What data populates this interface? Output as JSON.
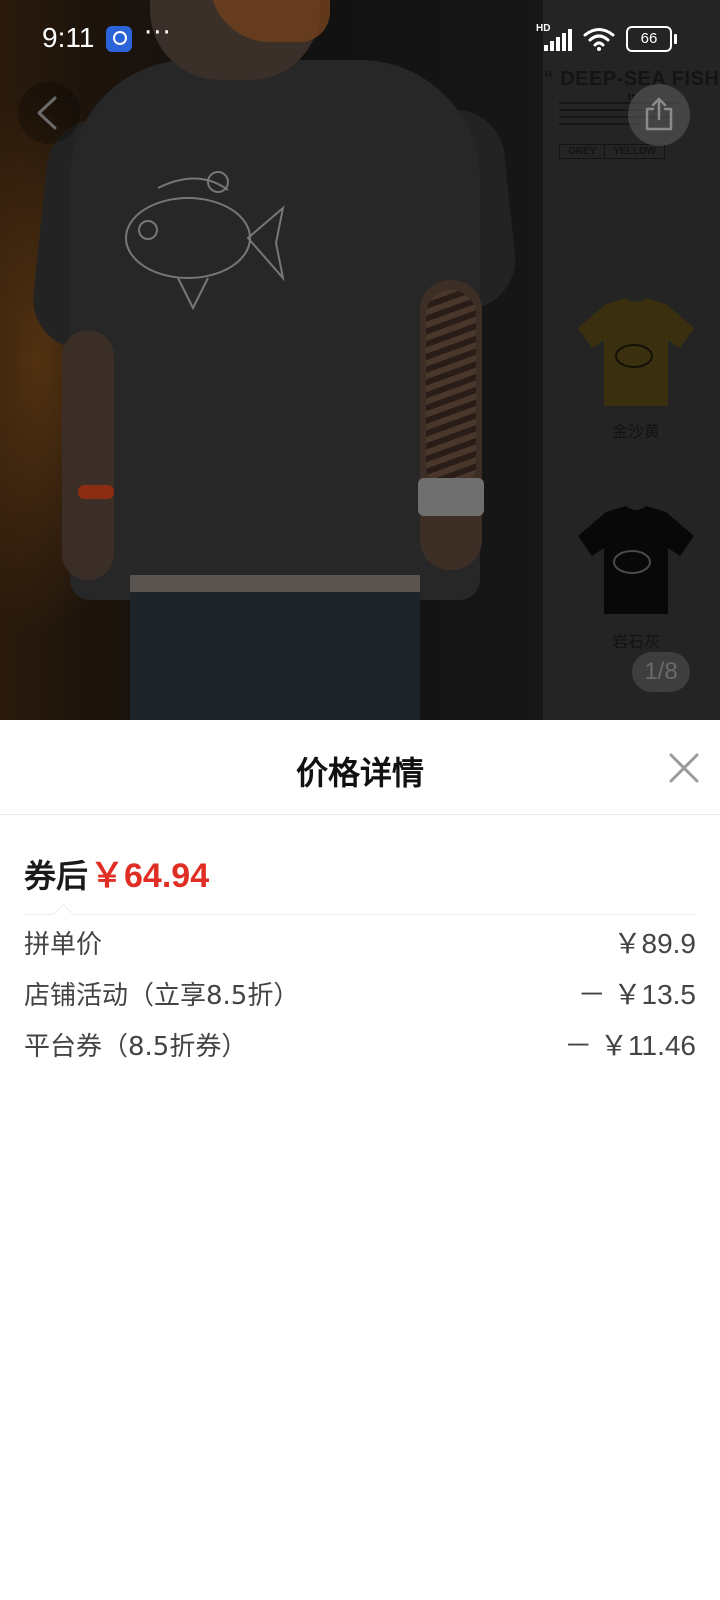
{
  "status_bar": {
    "time": "9:11",
    "more": "···",
    "network": "HD",
    "battery": "66"
  },
  "product_image": {
    "side_title": "“ DEEP-SEA FISH ”",
    "tags": [
      "GREY",
      "YELLOW"
    ],
    "swatches": [
      {
        "label": "金沙黄",
        "color": "#b7901c"
      },
      {
        "label": "岩石灰",
        "color": "#141414"
      }
    ],
    "pager": "1/8"
  },
  "sheet": {
    "title": "价格详情",
    "final_label": "券后",
    "final_price": "￥64.94",
    "rows": [
      {
        "label": "拼单价",
        "value": "￥89.9"
      },
      {
        "label": "店铺活动（立享8.5折）",
        "value": "－ ￥13.5"
      },
      {
        "label": "平台券（8.5折券）",
        "value": "－ ￥11.46"
      }
    ]
  },
  "colors": {
    "price_red": "#e02e24",
    "overlay": "rgba(0,0,0,0.72)"
  }
}
